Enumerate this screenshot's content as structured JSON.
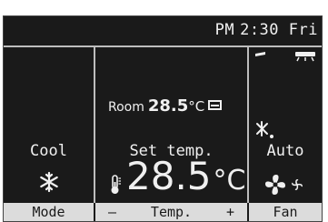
{
  "header": {
    "ampm": "PM",
    "time": "2:30",
    "day": "Fri"
  },
  "left": {
    "mode": "Cool",
    "mode_icon": "snowflake-icon"
  },
  "middle": {
    "room_label": "Room",
    "room_value": "28.5",
    "room_unit": "°C",
    "set_label": "Set temp.",
    "set_value": "28.5",
    "set_unit": "°C",
    "thermo_icon": "thermometer-icon"
  },
  "right": {
    "fan_mode": "Auto",
    "icons": [
      "vane-icon",
      "louver-icon",
      "swing-icon",
      "fan-icon"
    ]
  },
  "softkeys": {
    "mode": "Mode",
    "temp_minus": "—",
    "temp": "Temp.",
    "temp_plus": "+",
    "fan": "Fan"
  },
  "colors": {
    "screen_bg": "#1a1a1a",
    "text": "#f0f0f0",
    "softkey_bg": "#dcdcdc"
  }
}
